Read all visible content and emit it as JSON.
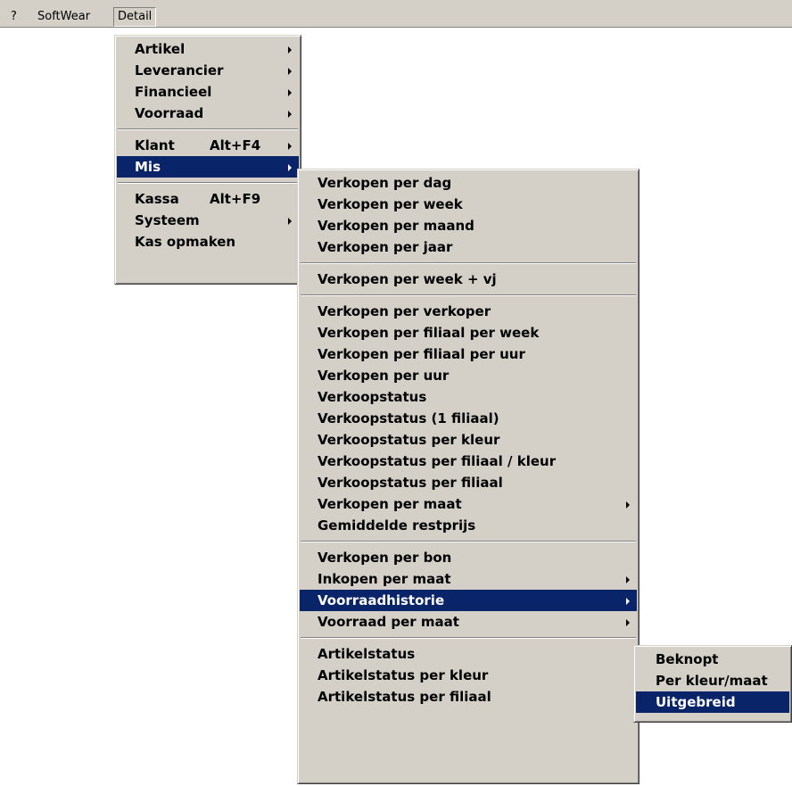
{
  "menubar": {
    "items": [
      {
        "label": "?"
      },
      {
        "label": "SoftWear"
      },
      {
        "label": "Detail"
      }
    ]
  },
  "detail_menu": {
    "items": [
      {
        "label": "Artikel",
        "has_submenu": true
      },
      {
        "label": "Leverancier",
        "has_submenu": true
      },
      {
        "label": "Financieel",
        "has_submenu": true
      },
      {
        "label": "Voorraad",
        "has_submenu": true
      },
      {
        "label": "Klant",
        "accelerator": "Alt+F4",
        "has_submenu": true
      },
      {
        "label": "Mis",
        "has_submenu": true,
        "selected": true
      },
      {
        "label": "Kassa",
        "accelerator": "Alt+F9"
      },
      {
        "label": "Systeem",
        "has_submenu": true
      },
      {
        "label": "Kas opmaken"
      }
    ]
  },
  "mis_menu": {
    "items": [
      {
        "label": "Verkopen per dag"
      },
      {
        "label": "Verkopen per week"
      },
      {
        "label": "Verkopen per maand"
      },
      {
        "label": "Verkopen per jaar"
      },
      {
        "label": "Verkopen per week + vj"
      },
      {
        "label": "Verkopen per verkoper"
      },
      {
        "label": "Verkopen per filiaal per week"
      },
      {
        "label": "Verkopen per filiaal per uur"
      },
      {
        "label": "Verkopen per uur"
      },
      {
        "label": "Verkoopstatus"
      },
      {
        "label": "Verkoopstatus (1 filiaal)"
      },
      {
        "label": "Verkoopstatus per kleur"
      },
      {
        "label": "Verkoopstatus per filiaal / kleur"
      },
      {
        "label": "Verkoopstatus per filiaal"
      },
      {
        "label": "Verkopen per maat",
        "has_submenu": true
      },
      {
        "label": "Gemiddelde restprijs"
      },
      {
        "label": "Verkopen per bon"
      },
      {
        "label": "Inkopen per maat",
        "has_submenu": true
      },
      {
        "label": "Voorraadhistorie",
        "has_submenu": true,
        "selected": true
      },
      {
        "label": "Voorraad per maat",
        "has_submenu": true
      },
      {
        "label": "Artikelstatus"
      },
      {
        "label": "Artikelstatus per kleur"
      },
      {
        "label": "Artikelstatus per filiaal"
      }
    ]
  },
  "voorraadhistorie_menu": {
    "items": [
      {
        "label": "Beknopt"
      },
      {
        "label": "Per kleur/maat"
      },
      {
        "label": "Uitgebreid",
        "selected": true
      }
    ]
  },
  "colors": {
    "menu_face": "#d4d0c8",
    "highlight": "#0a246a",
    "highlight_text": "#ffffff"
  }
}
